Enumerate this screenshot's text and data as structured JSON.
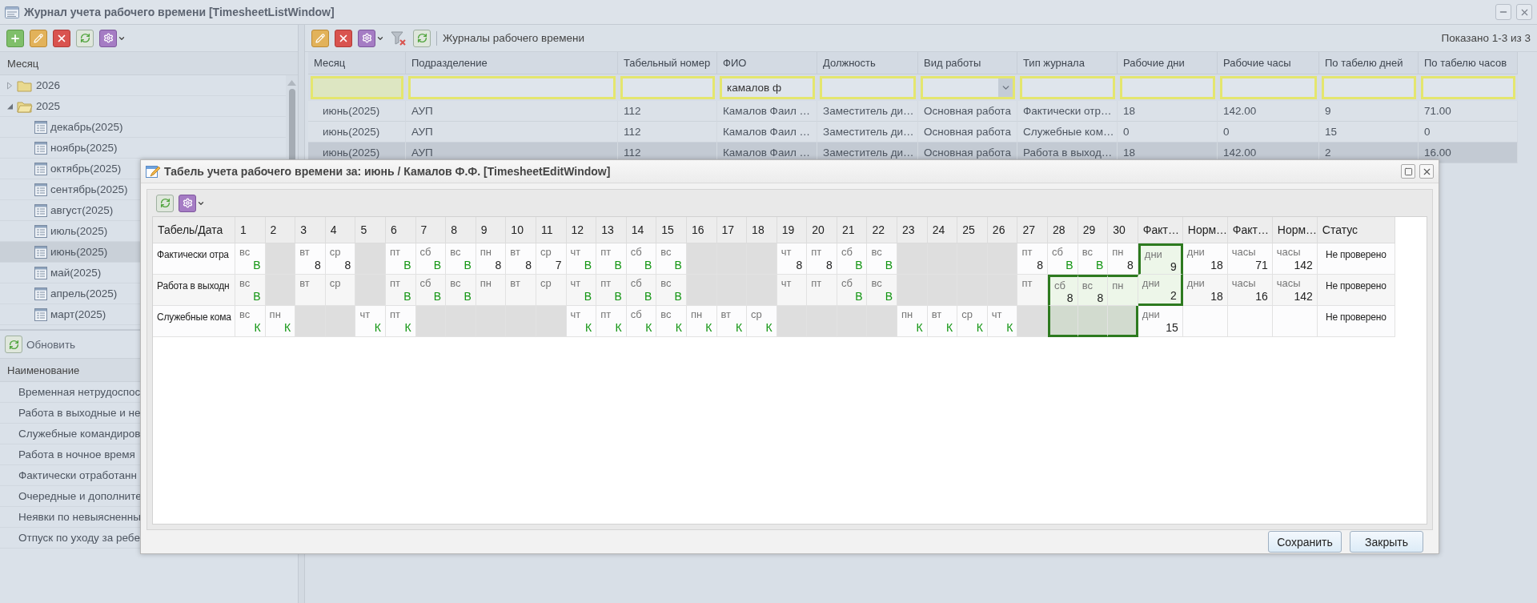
{
  "window": {
    "title": "Журнал учета рабочего времени [TimesheetListWindow]"
  },
  "months": {
    "header": "Месяц",
    "tree": [
      {
        "label": "2026",
        "expanded": false,
        "selected": false
      },
      {
        "label": "2025",
        "expanded": true,
        "selected": false,
        "children": [
          {
            "label": "декабрь(2025)",
            "selected": false
          },
          {
            "label": "ноябрь(2025)",
            "selected": false
          },
          {
            "label": "октябрь(2025)",
            "selected": false
          },
          {
            "label": "сентябрь(2025)",
            "selected": false
          },
          {
            "label": "август(2025)",
            "selected": false
          },
          {
            "label": "июль(2025)",
            "selected": false
          },
          {
            "label": "июнь(2025)",
            "selected": true
          },
          {
            "label": "май(2025)",
            "selected": false
          },
          {
            "label": "апрель(2025)",
            "selected": false
          },
          {
            "label": "март(2025)",
            "selected": false
          }
        ]
      }
    ]
  },
  "types": {
    "refresh_label": "Обновить",
    "header": "Наименование",
    "items": [
      "Временная нетрудоспос",
      "Работа в выходные и не",
      "Служебные командиров",
      "Работа в ночное время",
      "Фактически отработанн",
      "Очередные и дополните",
      "Неявки по невыясненны",
      "Отпуск по уходу за ребе"
    ]
  },
  "journals": {
    "title": "Журналы рабочего времени",
    "paging": "Показано 1-3 из 3",
    "columns": [
      {
        "label": "Месяц",
        "filter": {
          "kind": "text",
          "focused": true
        }
      },
      {
        "label": "Подразделение",
        "filter": {
          "kind": "text",
          "focused": false
        }
      },
      {
        "label": "Табельный номер",
        "filter": {
          "kind": "text",
          "focused": false
        }
      },
      {
        "label": "ФИО",
        "filter": {
          "kind": "text",
          "value": "камалов ф",
          "focused": false
        }
      },
      {
        "label": "Должность",
        "filter": {
          "kind": "text",
          "focused": false
        }
      },
      {
        "label": "Вид работы",
        "filter": {
          "kind": "combo",
          "focused": false
        }
      },
      {
        "label": "Тип журнала",
        "filter": {
          "kind": "text",
          "focused": false
        }
      },
      {
        "label": "Рабочие дни",
        "filter": {
          "kind": "text",
          "focused": false
        }
      },
      {
        "label": "Рабочие часы",
        "filter": {
          "kind": "text",
          "focused": false
        }
      },
      {
        "label": "По табелю дней",
        "filter": {
          "kind": "text",
          "focused": false
        }
      },
      {
        "label": "По табелю часов",
        "filter": {
          "kind": "text",
          "focused": false
        }
      }
    ],
    "rows": [
      {
        "selected": false,
        "cells": [
          "июнь(2025)",
          "АУП",
          "112",
          "Камалов Фаил …",
          "Заместитель ди…",
          "Основная работа",
          "Фактически отр…",
          "18",
          "142.00",
          "9",
          "71.00"
        ]
      },
      {
        "selected": false,
        "cells": [
          "июнь(2025)",
          "АУП",
          "112",
          "Камалов Фаил …",
          "Заместитель ди…",
          "Основная работа",
          "Служебные ком…",
          "0",
          "0",
          "15",
          "0"
        ]
      },
      {
        "selected": true,
        "cells": [
          "июнь(2025)",
          "АУП",
          "112",
          "Камалов Фаил …",
          "Заместитель ди…",
          "Основная работа",
          "Работа в выход…",
          "18",
          "142.00",
          "2",
          "16.00"
        ]
      }
    ]
  },
  "timesheet": {
    "title": "Табель учета рабочего времени за: июнь / Камалов Ф.Ф. [TimesheetEditWindow]",
    "columns": [
      "Табель/Дата",
      "1",
      "2",
      "3",
      "4",
      "5",
      "6",
      "7",
      "8",
      "9",
      "10",
      "11",
      "12",
      "13",
      "14",
      "15",
      "16",
      "17",
      "18",
      "19",
      "20",
      "21",
      "22",
      "23",
      "24",
      "25",
      "26",
      "27",
      "28",
      "29",
      "30",
      "Факт…",
      "Норм…",
      "Факт…",
      "Норм…",
      "Статус"
    ],
    "rows": [
      {
        "label": "Фактически отра",
        "status": "Не проверено",
        "days": [
          {
            "kind": "mark",
            "weekday": "вс",
            "value": "В",
            "selected": false
          },
          {
            "kind": "off",
            "selected": false
          },
          {
            "kind": "hours",
            "weekday": "вт",
            "value": "8",
            "selected": false
          },
          {
            "kind": "hours",
            "weekday": "ср",
            "value": "8",
            "selected": false
          },
          {
            "kind": "off",
            "selected": false
          },
          {
            "kind": "mark",
            "weekday": "пт",
            "value": "В",
            "selected": false
          },
          {
            "kind": "mark",
            "weekday": "сб",
            "value": "В",
            "selected": false
          },
          {
            "kind": "mark",
            "weekday": "вс",
            "value": "В",
            "selected": false
          },
          {
            "kind": "hours",
            "weekday": "пн",
            "value": "8",
            "selected": false
          },
          {
            "kind": "hours",
            "weekday": "вт",
            "value": "8",
            "selected": false
          },
          {
            "kind": "hours",
            "weekday": "ср",
            "value": "7",
            "selected": false
          },
          {
            "kind": "mark",
            "weekday": "чт",
            "value": "В",
            "selected": false
          },
          {
            "kind": "mark",
            "weekday": "пт",
            "value": "В",
            "selected": false
          },
          {
            "kind": "mark",
            "weekday": "сб",
            "value": "В",
            "selected": false
          },
          {
            "kind": "mark",
            "weekday": "вс",
            "value": "В",
            "selected": false
          },
          {
            "kind": "off",
            "selected": false
          },
          {
            "kind": "off",
            "selected": false
          },
          {
            "kind": "off",
            "selected": false
          },
          {
            "kind": "hours",
            "weekday": "чт",
            "value": "8",
            "selected": false
          },
          {
            "kind": "hours",
            "weekday": "пт",
            "value": "8",
            "selected": false
          },
          {
            "kind": "mark",
            "weekday": "сб",
            "value": "В",
            "selected": false
          },
          {
            "kind": "mark",
            "weekday": "вс",
            "value": "В",
            "selected": false
          },
          {
            "kind": "off",
            "selected": false
          },
          {
            "kind": "off",
            "selected": false
          },
          {
            "kind": "off",
            "selected": false
          },
          {
            "kind": "off",
            "selected": false
          },
          {
            "kind": "hours",
            "weekday": "пт",
            "value": "8",
            "selected": false
          },
          {
            "kind": "mark",
            "weekday": "сб",
            "value": "В",
            "selected": false
          },
          {
            "kind": "mark",
            "weekday": "вс",
            "value": "В",
            "selected": false
          },
          {
            "kind": "hours",
            "weekday": "пн",
            "value": "8",
            "selected": false
          }
        ],
        "totals": [
          {
            "unit": "дни",
            "value": "9",
            "selected": true
          },
          {
            "unit": "дни",
            "value": "18",
            "selected": false
          },
          {
            "unit": "часы",
            "value": "71",
            "selected": false
          },
          {
            "unit": "часы",
            "value": "142",
            "selected": false
          }
        ]
      },
      {
        "label": "Работа в выходн",
        "status": "Не проверено",
        "days": [
          {
            "kind": "mark",
            "weekday": "вс",
            "value": "В",
            "selected": false
          },
          {
            "kind": "off",
            "selected": false
          },
          {
            "kind": "blank",
            "weekday": "вт",
            "selected": false
          },
          {
            "kind": "blank",
            "weekday": "ср",
            "selected": false
          },
          {
            "kind": "off",
            "selected": false
          },
          {
            "kind": "mark",
            "weekday": "пт",
            "value": "В",
            "selected": false
          },
          {
            "kind": "mark",
            "weekday": "сб",
            "value": "В",
            "selected": false
          },
          {
            "kind": "mark",
            "weekday": "вс",
            "value": "В",
            "selected": false
          },
          {
            "kind": "blank",
            "weekday": "пн",
            "selected": false
          },
          {
            "kind": "blank",
            "weekday": "вт",
            "selected": false
          },
          {
            "kind": "blank",
            "weekday": "ср",
            "selected": false
          },
          {
            "kind": "mark",
            "weekday": "чт",
            "value": "В",
            "selected": false
          },
          {
            "kind": "mark",
            "weekday": "пт",
            "value": "В",
            "selected": false
          },
          {
            "kind": "mark",
            "weekday": "сб",
            "value": "В",
            "selected": false
          },
          {
            "kind": "mark",
            "weekday": "вс",
            "value": "В",
            "selected": false
          },
          {
            "kind": "off",
            "selected": false
          },
          {
            "kind": "off",
            "selected": false
          },
          {
            "kind": "off",
            "selected": false
          },
          {
            "kind": "blank",
            "weekday": "чт",
            "selected": false
          },
          {
            "kind": "blank",
            "weekday": "пт",
            "selected": false
          },
          {
            "kind": "mark",
            "weekday": "сб",
            "value": "В",
            "selected": false
          },
          {
            "kind": "mark",
            "weekday": "вс",
            "value": "В",
            "selected": false
          },
          {
            "kind": "off",
            "selected": false
          },
          {
            "kind": "off",
            "selected": false
          },
          {
            "kind": "off",
            "selected": false
          },
          {
            "kind": "off",
            "selected": false
          },
          {
            "kind": "blank",
            "weekday": "пт",
            "selected": false
          },
          {
            "kind": "hours",
            "weekday": "сб",
            "value": "8",
            "selected": true
          },
          {
            "kind": "hours",
            "weekday": "вс",
            "value": "8",
            "selected": true
          },
          {
            "kind": "blank",
            "weekday": "пн",
            "selected": true
          }
        ],
        "totals": [
          {
            "unit": "дни",
            "value": "2",
            "selected": true
          },
          {
            "unit": "дни",
            "value": "18",
            "selected": false
          },
          {
            "unit": "часы",
            "value": "16",
            "selected": false
          },
          {
            "unit": "часы",
            "value": "142",
            "selected": false
          }
        ]
      },
      {
        "label": "Служебные кома",
        "status": "Не проверено",
        "days": [
          {
            "kind": "mark",
            "weekday": "вс",
            "value": "К",
            "selected": false
          },
          {
            "kind": "mark",
            "weekday": "пн",
            "value": "К",
            "selected": false
          },
          {
            "kind": "off",
            "selected": false
          },
          {
            "kind": "off",
            "selected": false
          },
          {
            "kind": "mark",
            "weekday": "чт",
            "value": "К",
            "selected": false
          },
          {
            "kind": "mark",
            "weekday": "пт",
            "value": "К",
            "selected": false
          },
          {
            "kind": "off",
            "selected": false
          },
          {
            "kind": "off",
            "selected": false
          },
          {
            "kind": "off",
            "selected": false
          },
          {
            "kind": "off",
            "selected": false
          },
          {
            "kind": "off",
            "selected": false
          },
          {
            "kind": "mark",
            "weekday": "чт",
            "value": "К",
            "selected": false
          },
          {
            "kind": "mark",
            "weekday": "пт",
            "value": "К",
            "selected": false
          },
          {
            "kind": "mark",
            "weekday": "сб",
            "value": "К",
            "selected": false
          },
          {
            "kind": "mark",
            "weekday": "вс",
            "value": "К",
            "selected": false
          },
          {
            "kind": "mark",
            "weekday": "пн",
            "value": "К",
            "selected": false
          },
          {
            "kind": "mark",
            "weekday": "вт",
            "value": "К",
            "selected": false
          },
          {
            "kind": "mark",
            "weekday": "ср",
            "value": "К",
            "selected": false
          },
          {
            "kind": "off",
            "selected": false
          },
          {
            "kind": "off",
            "selected": false
          },
          {
            "kind": "off",
            "selected": false
          },
          {
            "kind": "off",
            "selected": false
          },
          {
            "kind": "mark",
            "weekday": "пн",
            "value": "К",
            "selected": false
          },
          {
            "kind": "mark",
            "weekday": "вт",
            "value": "К",
            "selected": false
          },
          {
            "kind": "mark",
            "weekday": "ср",
            "value": "К",
            "selected": false
          },
          {
            "kind": "mark",
            "weekday": "чт",
            "value": "К",
            "selected": false
          },
          {
            "kind": "off",
            "selected": false
          },
          {
            "kind": "off",
            "selected": true
          },
          {
            "kind": "off",
            "selected": true
          },
          {
            "kind": "off",
            "selected": true
          }
        ],
        "totals": [
          {
            "unit": "дни",
            "value": "15",
            "selected": false
          },
          {
            "selected": false
          },
          {
            "selected": false
          },
          {
            "selected": false
          }
        ]
      }
    ],
    "buttons": [
      "Сохранить",
      "Закрыть"
    ]
  }
}
